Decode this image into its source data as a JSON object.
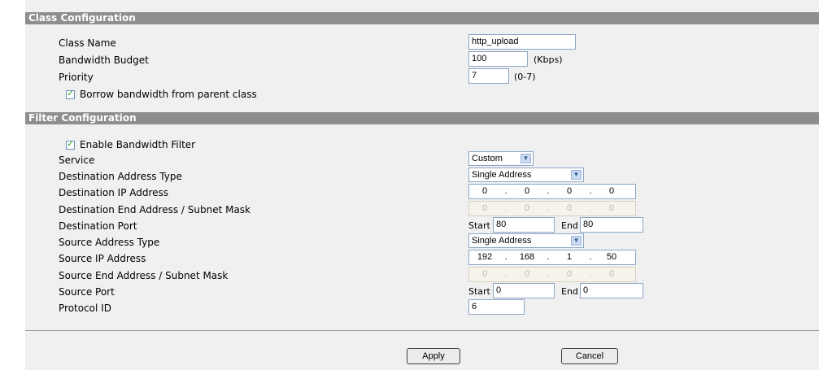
{
  "class_config": {
    "header": "Class Configuration",
    "class_name_label": "Class Name",
    "class_name_value": "http_upload",
    "bandwidth_label": "Bandwidth Budget",
    "bandwidth_value": "100",
    "bandwidth_unit": "(Kbps)",
    "priority_label": "Priority",
    "priority_value": "7",
    "priority_range": "(0-7)",
    "borrow_label": "Borrow bandwidth from parent class",
    "borrow_checked": true
  },
  "filter_config": {
    "header": "Filter Configuration",
    "enable_label": "Enable Bandwidth Filter",
    "enable_checked": true,
    "service_label": "Service",
    "service_value": "Custom",
    "dest_type_label": "Destination Address Type",
    "dest_type_value": "Single Address",
    "dest_ip_label": "Destination IP Address",
    "dest_ip": [
      "0",
      "0",
      "0",
      "0"
    ],
    "dest_end_label": "Destination End Address / Subnet Mask",
    "dest_end": [
      "0",
      "0",
      "0",
      "0"
    ],
    "dest_port_label": "Destination Port",
    "dest_port_start_label": "Start",
    "dest_port_start": "80",
    "dest_port_end_label": "End",
    "dest_port_end": "80",
    "src_type_label": "Source Address Type",
    "src_type_value": "Single Address",
    "src_ip_label": "Source IP Address",
    "src_ip": [
      "192",
      "168",
      "1",
      "50"
    ],
    "src_end_label": "Source End Address / Subnet Mask",
    "src_end": [
      "0",
      "0",
      "0",
      "0"
    ],
    "src_port_label": "Source Port",
    "src_port_start_label": "Start",
    "src_port_start": "0",
    "src_port_end_label": "End",
    "src_port_end": "0",
    "protocol_label": "Protocol ID",
    "protocol_value": "6"
  },
  "buttons": {
    "apply": "Apply",
    "cancel": "Cancel"
  },
  "icons": {
    "checkbox": "checkmark-icon",
    "dropdown": "chevron-down-icon"
  },
  "colors": {
    "header_bg": "#8e8e8e",
    "panel_bg": "#f0f0f0",
    "check": "#1f9a1f"
  }
}
